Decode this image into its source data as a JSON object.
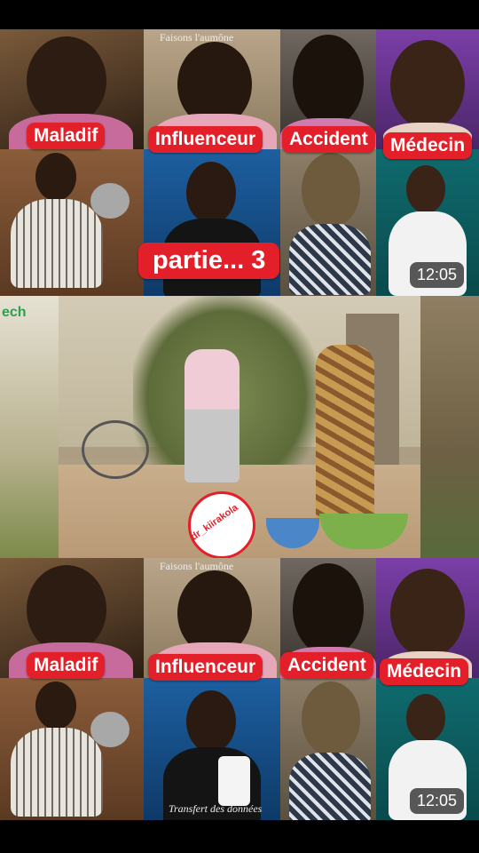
{
  "labels": {
    "maladif": "Maladif",
    "influenceur": "Influenceur",
    "accident": "Accident",
    "medecin": "Médecin"
  },
  "top_banner": "Faisons l'aumône",
  "duration": "12:05",
  "part_label": "partie... 3",
  "logo_text": "ech",
  "watermark": "dr_kiirakola",
  "caption_bottom": "Transfert des données"
}
